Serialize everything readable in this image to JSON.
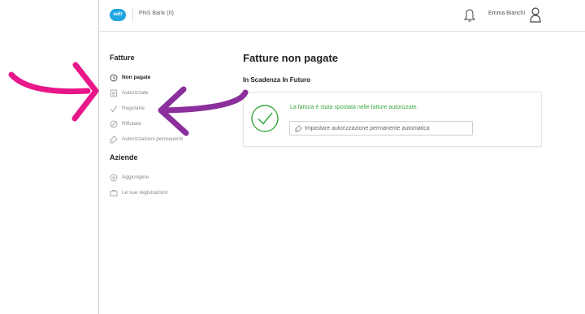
{
  "header": {
    "logo_text": "edit",
    "bank_name": "PNS Bank (It)",
    "user_name": "Emma Bianchi"
  },
  "sidebar": {
    "fatture_title": "Fatture",
    "fatture_items": [
      {
        "label": "Non pagate",
        "icon": "clock-icon",
        "active": true
      },
      {
        "label": "Autorizzate",
        "icon": "document-icon",
        "active": false
      },
      {
        "label": "Regolarie",
        "icon": "check-icon",
        "active": false
      },
      {
        "label": "Rifiutate",
        "icon": "forbidden-icon",
        "active": false
      },
      {
        "label": "Autorizzazioni permanenti",
        "icon": "tag-icon",
        "active": false
      }
    ],
    "aziende_title": "Aziende",
    "aziende_items": [
      {
        "label": "Aggiungere",
        "icon": "plus-circle-icon"
      },
      {
        "label": "Le sue registrazioni",
        "icon": "folder-icon"
      }
    ]
  },
  "main": {
    "title": "Fatture non pagate",
    "subheading": "In Scadenza In Futuro",
    "success_message": "La fattura è stata spostata nelle fatture autorizzate.",
    "auto_button_label": "Impostare autorizzazione permanente automatica"
  },
  "colors": {
    "logo": "#1fa5e0",
    "success": "#3aa83e",
    "arrow_pink": "#e8178a",
    "arrow_purple": "#8b2f9c"
  }
}
